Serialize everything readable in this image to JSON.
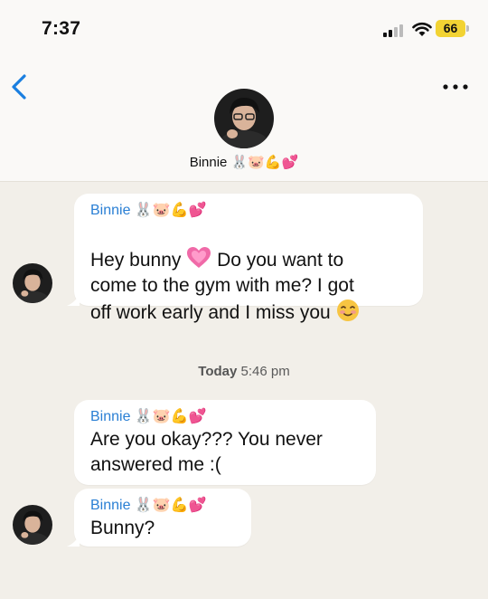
{
  "status_bar": {
    "time": "7:37",
    "battery": "66"
  },
  "header": {
    "contact_name": "Binnie 🐰🐷💪💕"
  },
  "messages": [
    {
      "sender": "Binnie 🐰🐷💪💕",
      "text_parts": [
        "Hey bunny ",
        " Do you want to\ncome to the gym with me? I got\noff work early and I miss you "
      ],
      "inline_emoji": [
        "heart-icon",
        "smiling-face-icon"
      ]
    },
    {
      "sender": "Binnie 🐰🐷💪💕",
      "text": "Are you okay??? You never\nanswered me :("
    },
    {
      "sender": "Binnie 🐰🐷💪💕",
      "text": "Bunny?"
    }
  ],
  "date_separator": {
    "day": "Today",
    "time": "5:46 pm"
  },
  "colors": {
    "accent": "#2a7fd4",
    "background": "#f2efe9",
    "bubble": "#ffffff",
    "battery": "#f2d333"
  }
}
